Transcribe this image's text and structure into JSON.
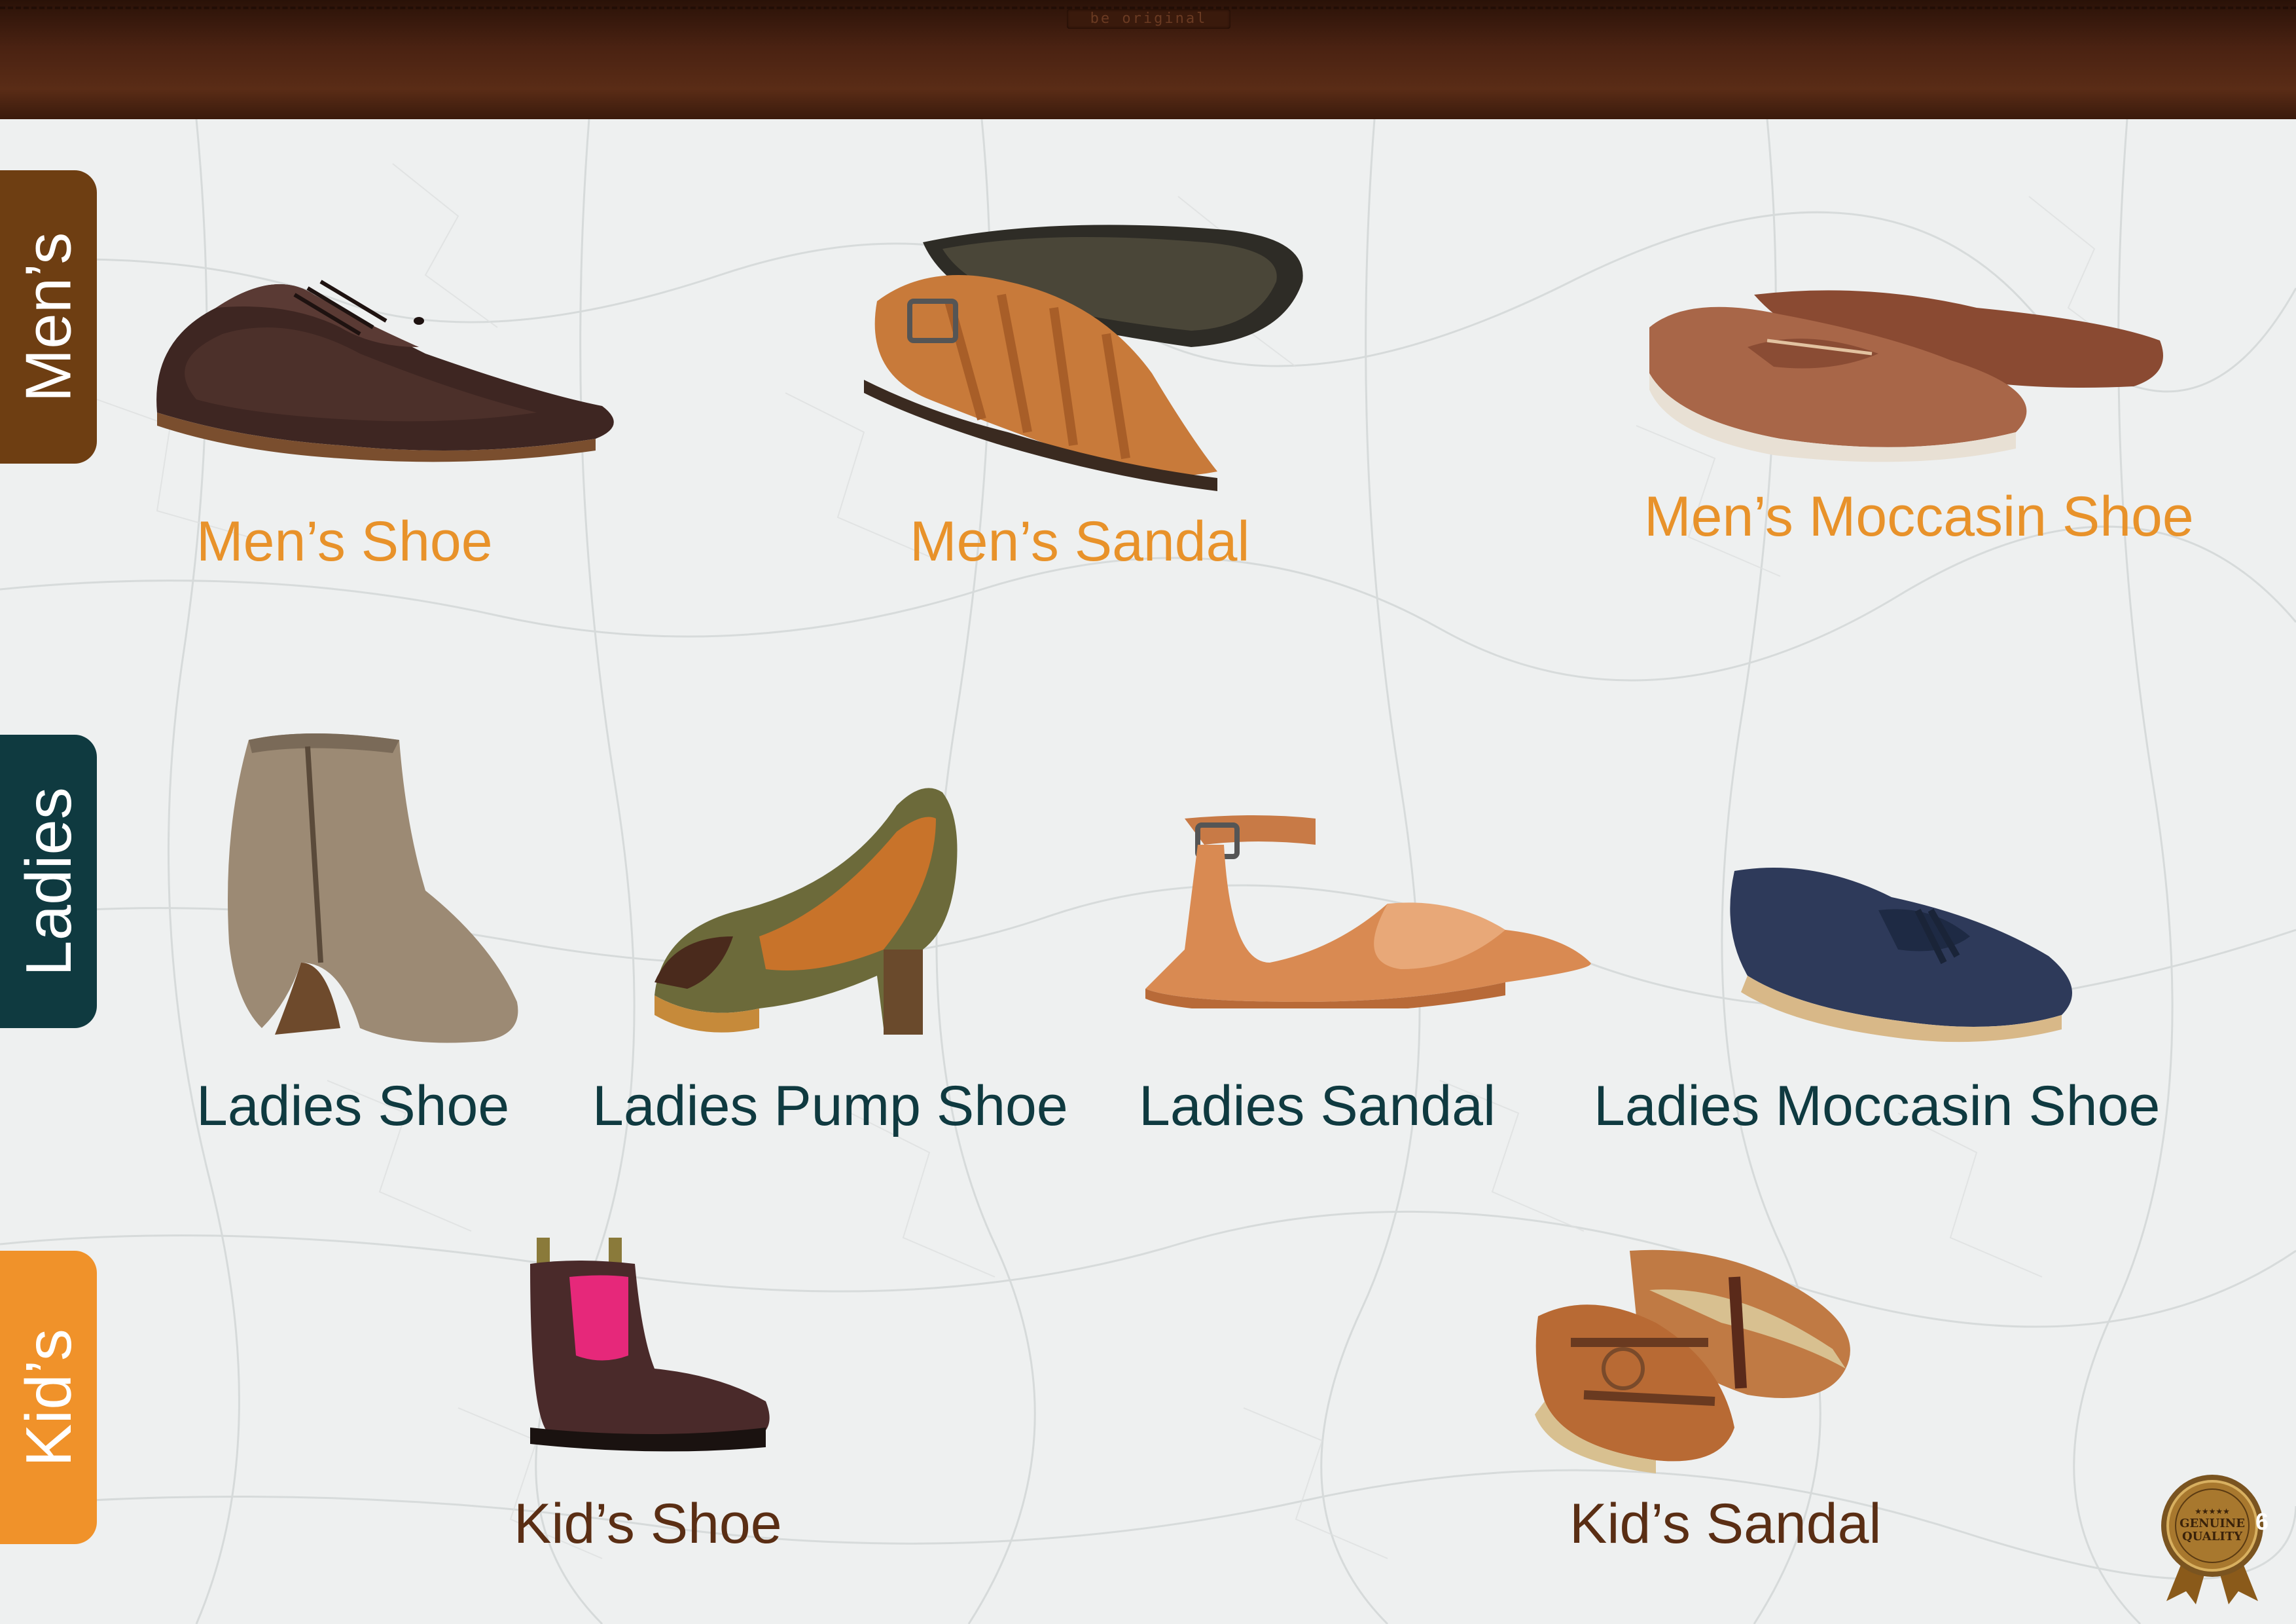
{
  "header": {
    "slogan": "be original"
  },
  "tabs": {
    "mens": "Men’s",
    "ladies": "Ladies",
    "kids": "Kid’s"
  },
  "products": {
    "mens_shoe": "Men’s Shoe",
    "mens_sandal": "Men’s Sandal",
    "mens_moccasin": "Men’s Moccasin Shoe",
    "ladies_shoe": "Ladies Shoe",
    "ladies_pump": "Ladies Pump Shoe",
    "ladies_sandal": "Ladies Sandal",
    "ladies_moccasin": "Ladies Moccasin Shoe",
    "kids_shoe": "Kid’s Shoe",
    "kids_sandal": "Kid’s Sandal"
  },
  "badge": {
    "line1": "GENUINE",
    "line2": "QUALITY",
    "stars": "★★★★★"
  },
  "page_number": "6",
  "colors": {
    "mens": "#6e3e12",
    "ladies": "#0f3a40",
    "kids": "#f0922a",
    "orange_label": "#e8922a",
    "brown_header": "#4a2212"
  }
}
